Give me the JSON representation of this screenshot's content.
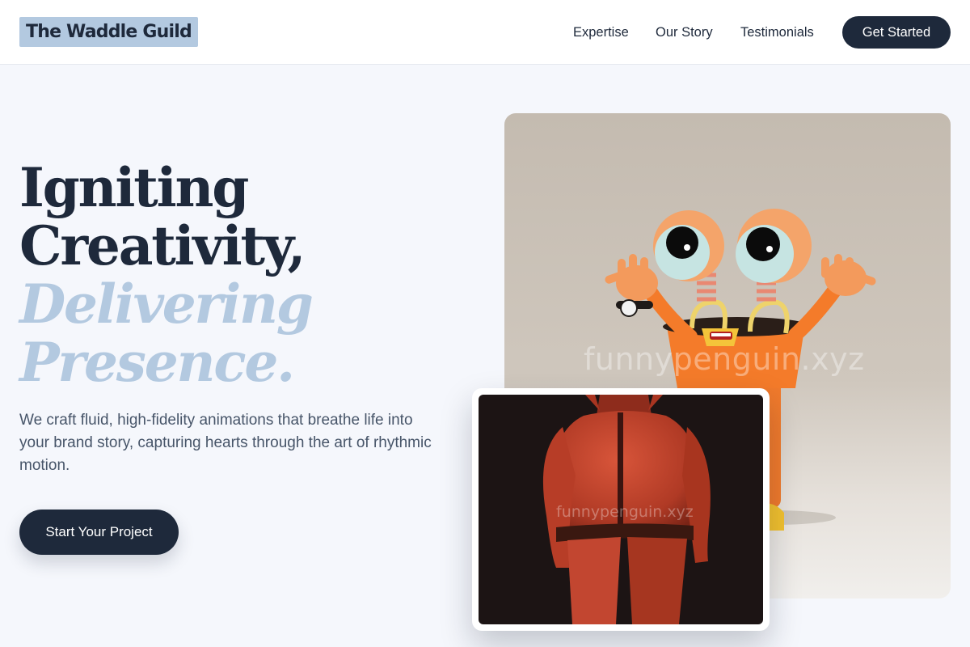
{
  "header": {
    "brand": "The Waddle Guild",
    "nav": [
      {
        "label": "Expertise"
      },
      {
        "label": "Our Story"
      },
      {
        "label": "Testimonials"
      }
    ],
    "cta_label": "Get Started"
  },
  "hero": {
    "headline_line1": "Igniting",
    "headline_line2": "Creativity,",
    "headline_accent_line1": "Delivering",
    "headline_accent_line2": "Presence.",
    "subcopy": "We craft fluid, high-fidelity animations that breathe life into your brand story, capturing hearts through the art of rhythmic motion.",
    "cta_label": "Start Your Project"
  },
  "media": {
    "main_image": {
      "subject": "orange cartoon robot with big eyes on springs",
      "watermark": "funnypenguin.xyz"
    },
    "card_image": {
      "subject": "red clay figure in jumpsuit seen from behind",
      "watermark": "funnypenguin.xyz"
    }
  },
  "colors": {
    "primary": "#1e293b",
    "accent": "#b3c9e0",
    "background": "#f5f7fc",
    "body_text": "#475569"
  }
}
